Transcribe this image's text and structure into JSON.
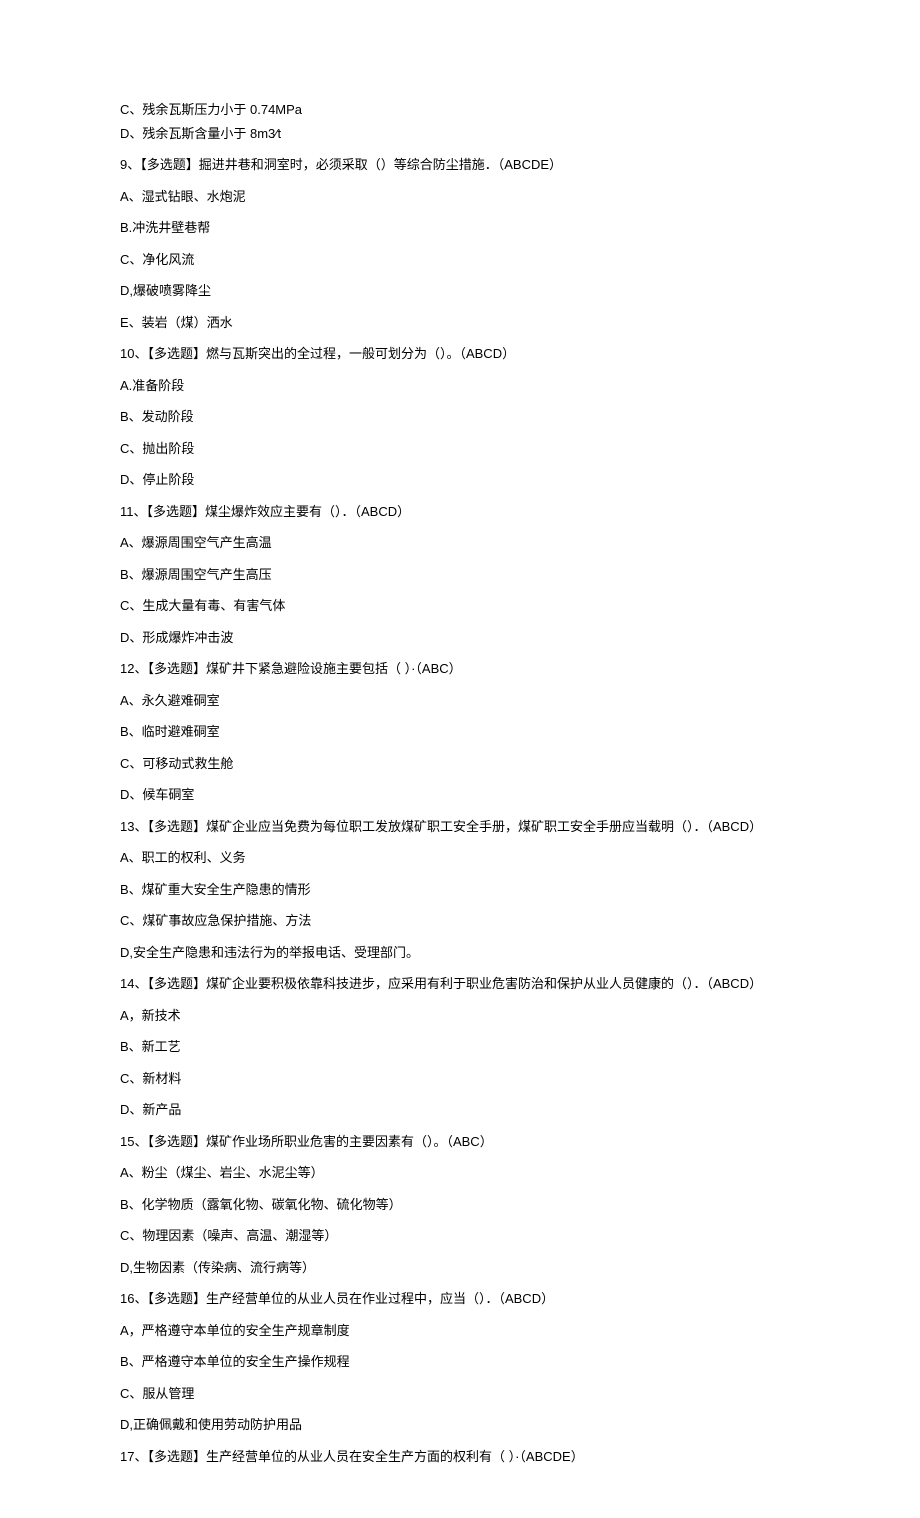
{
  "lines": [
    {
      "t": "C、残余瓦斯压力小于 0.74MPa",
      "tight": true
    },
    {
      "t": "D、残余瓦斯含量小于 8m3⁄t"
    },
    {
      "t": "9、【多选题】掘进井巷和洞室时，必须采取（）等综合防尘措施．（ABCDE）"
    },
    {
      "t": "A、湿式钻眼、水炮泥"
    },
    {
      "t": "B.冲洗井壁巷帮"
    },
    {
      "t": "C、净化风流"
    },
    {
      "t": "D,爆破喷雾降尘"
    },
    {
      "t": "E、装岩（煤）洒水"
    },
    {
      "t": "10、【多选题】燃与瓦斯突出的全过程，一般可划分为（）。（ABCD）"
    },
    {
      "t": "A.准备阶段"
    },
    {
      "t": "B、发动阶段"
    },
    {
      "t": "C、抛出阶段"
    },
    {
      "t": "D、停止阶段"
    },
    {
      "t": "11、【多选题】煤尘爆炸效应主要有（）．（ABCD）"
    },
    {
      "t": "A、爆源周围空气产生高温"
    },
    {
      "t": "B、爆源周围空气产生高压"
    },
    {
      "t": "C、生成大量有毒、有害气体"
    },
    {
      "t": "D、形成爆炸冲击波"
    },
    {
      "t": "12、【多选题】煤矿井下紧急避险设施主要包括（ ）·（ABC）"
    },
    {
      "t": "A、永久避难硐室"
    },
    {
      "t": "B、临时避难硐室"
    },
    {
      "t": "C、可移动式救生舱"
    },
    {
      "t": "D、候车硐室"
    },
    {
      "t": "13、【多选题】煤矿企业应当免费为每位职工发放煤矿职工安全手册，煤矿职工安全手册应当载明（）．（ABCD）"
    },
    {
      "t": "A、职工的权利、义务"
    },
    {
      "t": "B、煤矿重大安全生产隐患的情形"
    },
    {
      "t": "C、煤矿事故应急保护措施、方法"
    },
    {
      "t": "D,安全生产隐患和违法行为的举报电话、受理部门。"
    },
    {
      "t": "14、【多选题】煤矿企业要积极依靠科技进步，应采用有利于职业危害防治和保护从业人员健康的（）．（ABCD）"
    },
    {
      "t": "A，新技术"
    },
    {
      "t": "B、新工艺"
    },
    {
      "t": "C、新材料"
    },
    {
      "t": "D、新产品"
    },
    {
      "t": "15、【多选题】煤矿作业场所职业危害的主要因素有（）。（ABC）"
    },
    {
      "t": "A、粉尘（煤尘、岩尘、水泥尘等）"
    },
    {
      "t": "B、化学物质（露氧化物、碳氧化物、硫化物等）"
    },
    {
      "t": "C、物理因素（噪声、高温、潮湿等）"
    },
    {
      "t": "D,生物因素（传染病、流行病等）"
    },
    {
      "t": "16、【多选题】生产经营单位的从业人员在作业过程中，应当（）．（ABCD）"
    },
    {
      "t": "A，严格遵守本单位的安全生产规章制度"
    },
    {
      "t": "B、严格遵守本单位的安全生产操作规程"
    },
    {
      "t": "C、服从管理"
    },
    {
      "t": "D,正确佩戴和使用劳动防护用品"
    },
    {
      "t": "17、【多选题】生产经营单位的从业人员在安全生产方面的权利有（ ）·（ABCDE）"
    }
  ]
}
